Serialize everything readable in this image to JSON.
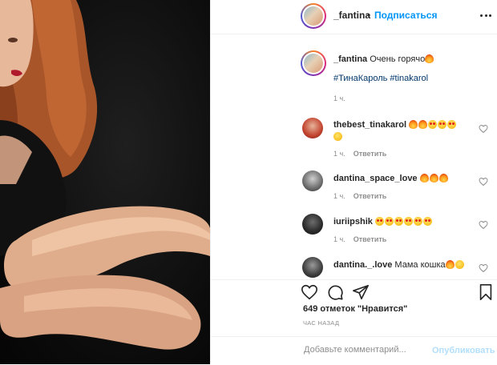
{
  "header": {
    "username": "_fantina",
    "separator": "•",
    "follow_label": "Подписаться"
  },
  "caption": {
    "username": "_fantina",
    "text": "Очень горячо",
    "emojis": [
      "fire"
    ],
    "hashtags": "#ТинаКароль #tinakarol",
    "time": "1 ч."
  },
  "comments": [
    {
      "username": "thebest_tinakarol",
      "text": "",
      "emojis": [
        "fire",
        "fire",
        "hearteyes",
        "hearteyes",
        "hearteyes",
        "smile"
      ],
      "time": "1 ч.",
      "reply_label": "Ответить"
    },
    {
      "username": "dantina_space_love",
      "text": "",
      "emojis": [
        "fire",
        "fire",
        "fire"
      ],
      "time": "1 ч.",
      "reply_label": "Ответить"
    },
    {
      "username": "iuriipshik",
      "text": "",
      "emojis": [
        "hearteyes",
        "hearteyes",
        "hearteyes",
        "hearteyes",
        "hearteyes",
        "hearteyes"
      ],
      "time": "1 ч.",
      "reply_label": "Ответить"
    },
    {
      "username": "dantina._.love",
      "text": "Мама кошка",
      "emojis": [
        "fire",
        "smile"
      ],
      "time": "",
      "reply_label": ""
    }
  ],
  "actions": {
    "like_icon": "heart-outline-icon",
    "comment_icon": "comment-bubble-icon",
    "share_icon": "paper-plane-icon",
    "save_icon": "bookmark-icon"
  },
  "likes_text": "649 отметок \"Нравится\"",
  "timestamp": "ЧАС НАЗАД",
  "add_comment": {
    "placeholder": "Добавьте комментарий...",
    "publish_label": "Опубликовать"
  },
  "colors": {
    "link_blue": "#0095f6",
    "hashtag": "#00376b",
    "muted": "#8e8e8e",
    "publish_disabled": "#b2dffc"
  }
}
